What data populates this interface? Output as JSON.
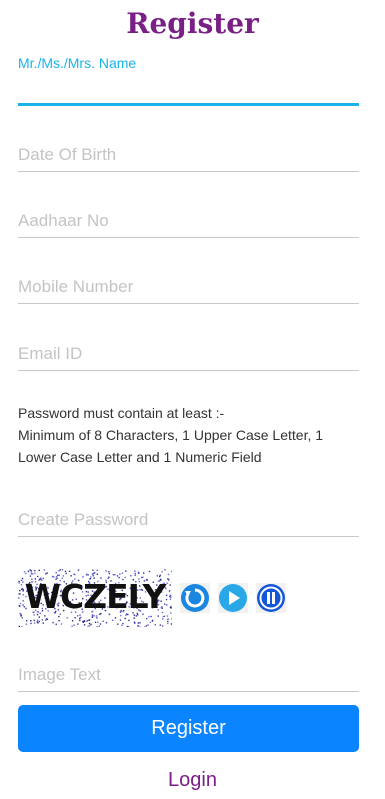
{
  "header": {
    "title": "Register"
  },
  "form": {
    "name_label": "Mr./Ms./Mrs. Name",
    "name_value": "",
    "dob_placeholder": "Date Of Birth",
    "aadhaar_placeholder": "Aadhaar No",
    "mobile_placeholder": "Mobile Number",
    "email_placeholder": "Email ID",
    "password_note_line1": "Password must contain at least :-",
    "password_note_line2": "Minimum of 8 Characters, 1 Upper Case Letter, 1 Lower Case Letter and 1 Numeric Field",
    "password_placeholder": "Create Password",
    "captcha_text": "WCZELY",
    "captcha_placeholder": "Image Text"
  },
  "captcha_controls": {
    "refresh_icon": "refresh-icon",
    "play_icon": "play-icon",
    "pause_icon": "pause-icon"
  },
  "actions": {
    "register_label": "Register",
    "login_label": "Login"
  },
  "colors": {
    "title": "#7a1f86",
    "accent": "#1ab2e8",
    "button": "#0a84ff"
  }
}
